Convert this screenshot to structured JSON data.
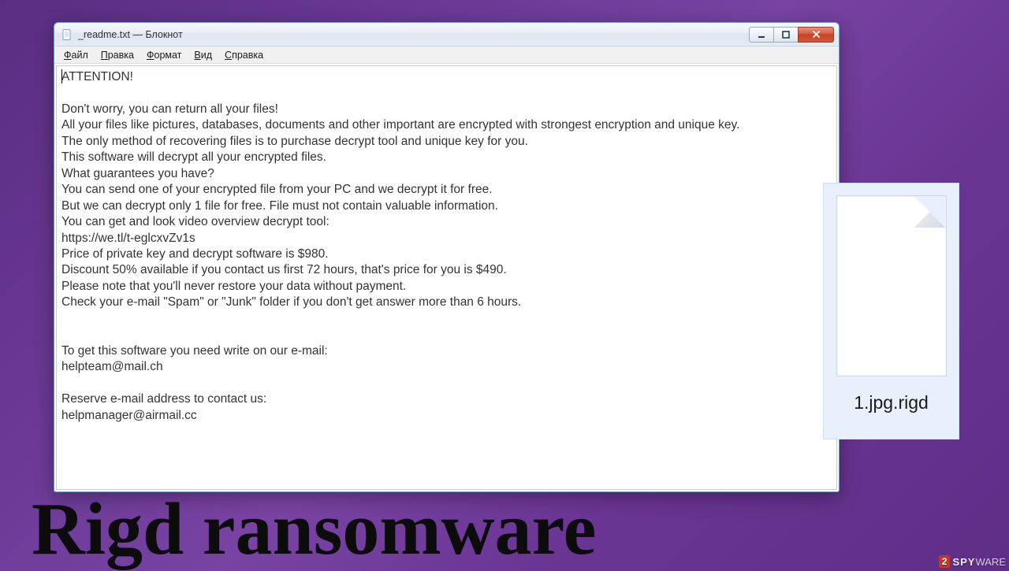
{
  "window": {
    "title": "_readme.txt — Блокнот"
  },
  "menu": {
    "file": "Файл",
    "edit": "Правка",
    "format": "Формат",
    "view": "Вид",
    "help": "Справка"
  },
  "ransom_note": {
    "body": "ATTENTION!\n\nDon't worry, you can return all your files!\nAll your files like pictures, databases, documents and other important are encrypted with strongest encryption and unique key.\nThe only method of recovering files is to purchase decrypt tool and unique key for you.\nThis software will decrypt all your encrypted files.\nWhat guarantees you have?\nYou can send one of your encrypted file from your PC and we decrypt it for free.\nBut we can decrypt only 1 file for free. File must not contain valuable information.\nYou can get and look video overview decrypt tool:\nhttps://we.tl/t-eglcxvZv1s\nPrice of private key and decrypt software is $980.\nDiscount 50% available if you contact us first 72 hours, that's price for you is $490.\nPlease note that you'll never restore your data without payment.\nCheck your e-mail \"Spam\" or \"Junk\" folder if you don't get answer more than 6 hours.\n\n\nTo get this software you need write on our e-mail:\nhelpteam@mail.ch\n\nReserve e-mail address to contact us:\nhelpmanager@airmail.cc"
  },
  "encrypted_file": {
    "name": "1.jpg.rigd"
  },
  "headline": "Rigd ransomware",
  "watermark": {
    "prefix": "2",
    "brand": "SPY",
    "suffix": "WARE"
  }
}
